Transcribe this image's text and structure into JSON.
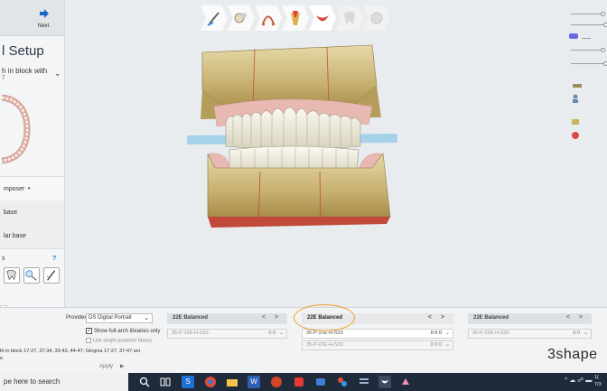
{
  "left_panel": {
    "next_label": "Next",
    "title": "l Setup",
    "block_label": "h in block with",
    "block_teeth": "7",
    "composer_label": "mposer",
    "composer_dot": "●",
    "base_label": "base",
    "mandibular_label": "lar base",
    "tools_label": "s",
    "tools_help": "?"
  },
  "bottom": {
    "provider_label": "Provider",
    "provider_value": "DS Digital Portrait",
    "show_full_label": "Show full-arch libraries only",
    "show_full_checked": "✓",
    "single_post_label": "Use single posterior library",
    "status_line": "th in block 17-27, 37-34, 33-43, 44-47; Gingiva 17-27, 37-47 set",
    "status_line2": "e",
    "apply_label": "Apply",
    "apply_arrow": "▶",
    "columns": [
      {
        "header": "22E Balanced",
        "nav": "< >",
        "row1": "35-P-22E-H-S33",
        "row1_val": "0 0",
        "row2": "",
        "row2_val": ""
      },
      {
        "header": "22E Balanced",
        "nav": "< >",
        "row1": "35-P-22E-H-S33",
        "row1_val": "0 0 0",
        "row2": "35-P-22E-H-S33",
        "row2_val": "0 0 0"
      },
      {
        "header": "22E Balanced",
        "nav": "< >",
        "row1": "35-P-22E-H-S33",
        "row1_val": "0 0",
        "row2": "",
        "row2_val": ""
      }
    ],
    "brand": "3shape"
  },
  "taskbar": {
    "search_text": "pe here to search",
    "clock_time": "1(",
    "clock_date": "7/3"
  },
  "colors": {
    "highlight": "#f0a02a",
    "gingiva": "#e8b9b3",
    "denture_base": "#c9b37a",
    "teeth": "#f3f0e2",
    "occlusal_plane": "#8ec9e6"
  },
  "toolbar_icons": [
    "tooth-prep-icon",
    "tooth-setup-icon",
    "arch-icon",
    "gingiva-icon",
    "mouth-icon",
    "tooth-disabled-icon",
    "sphere-disabled-icon"
  ]
}
